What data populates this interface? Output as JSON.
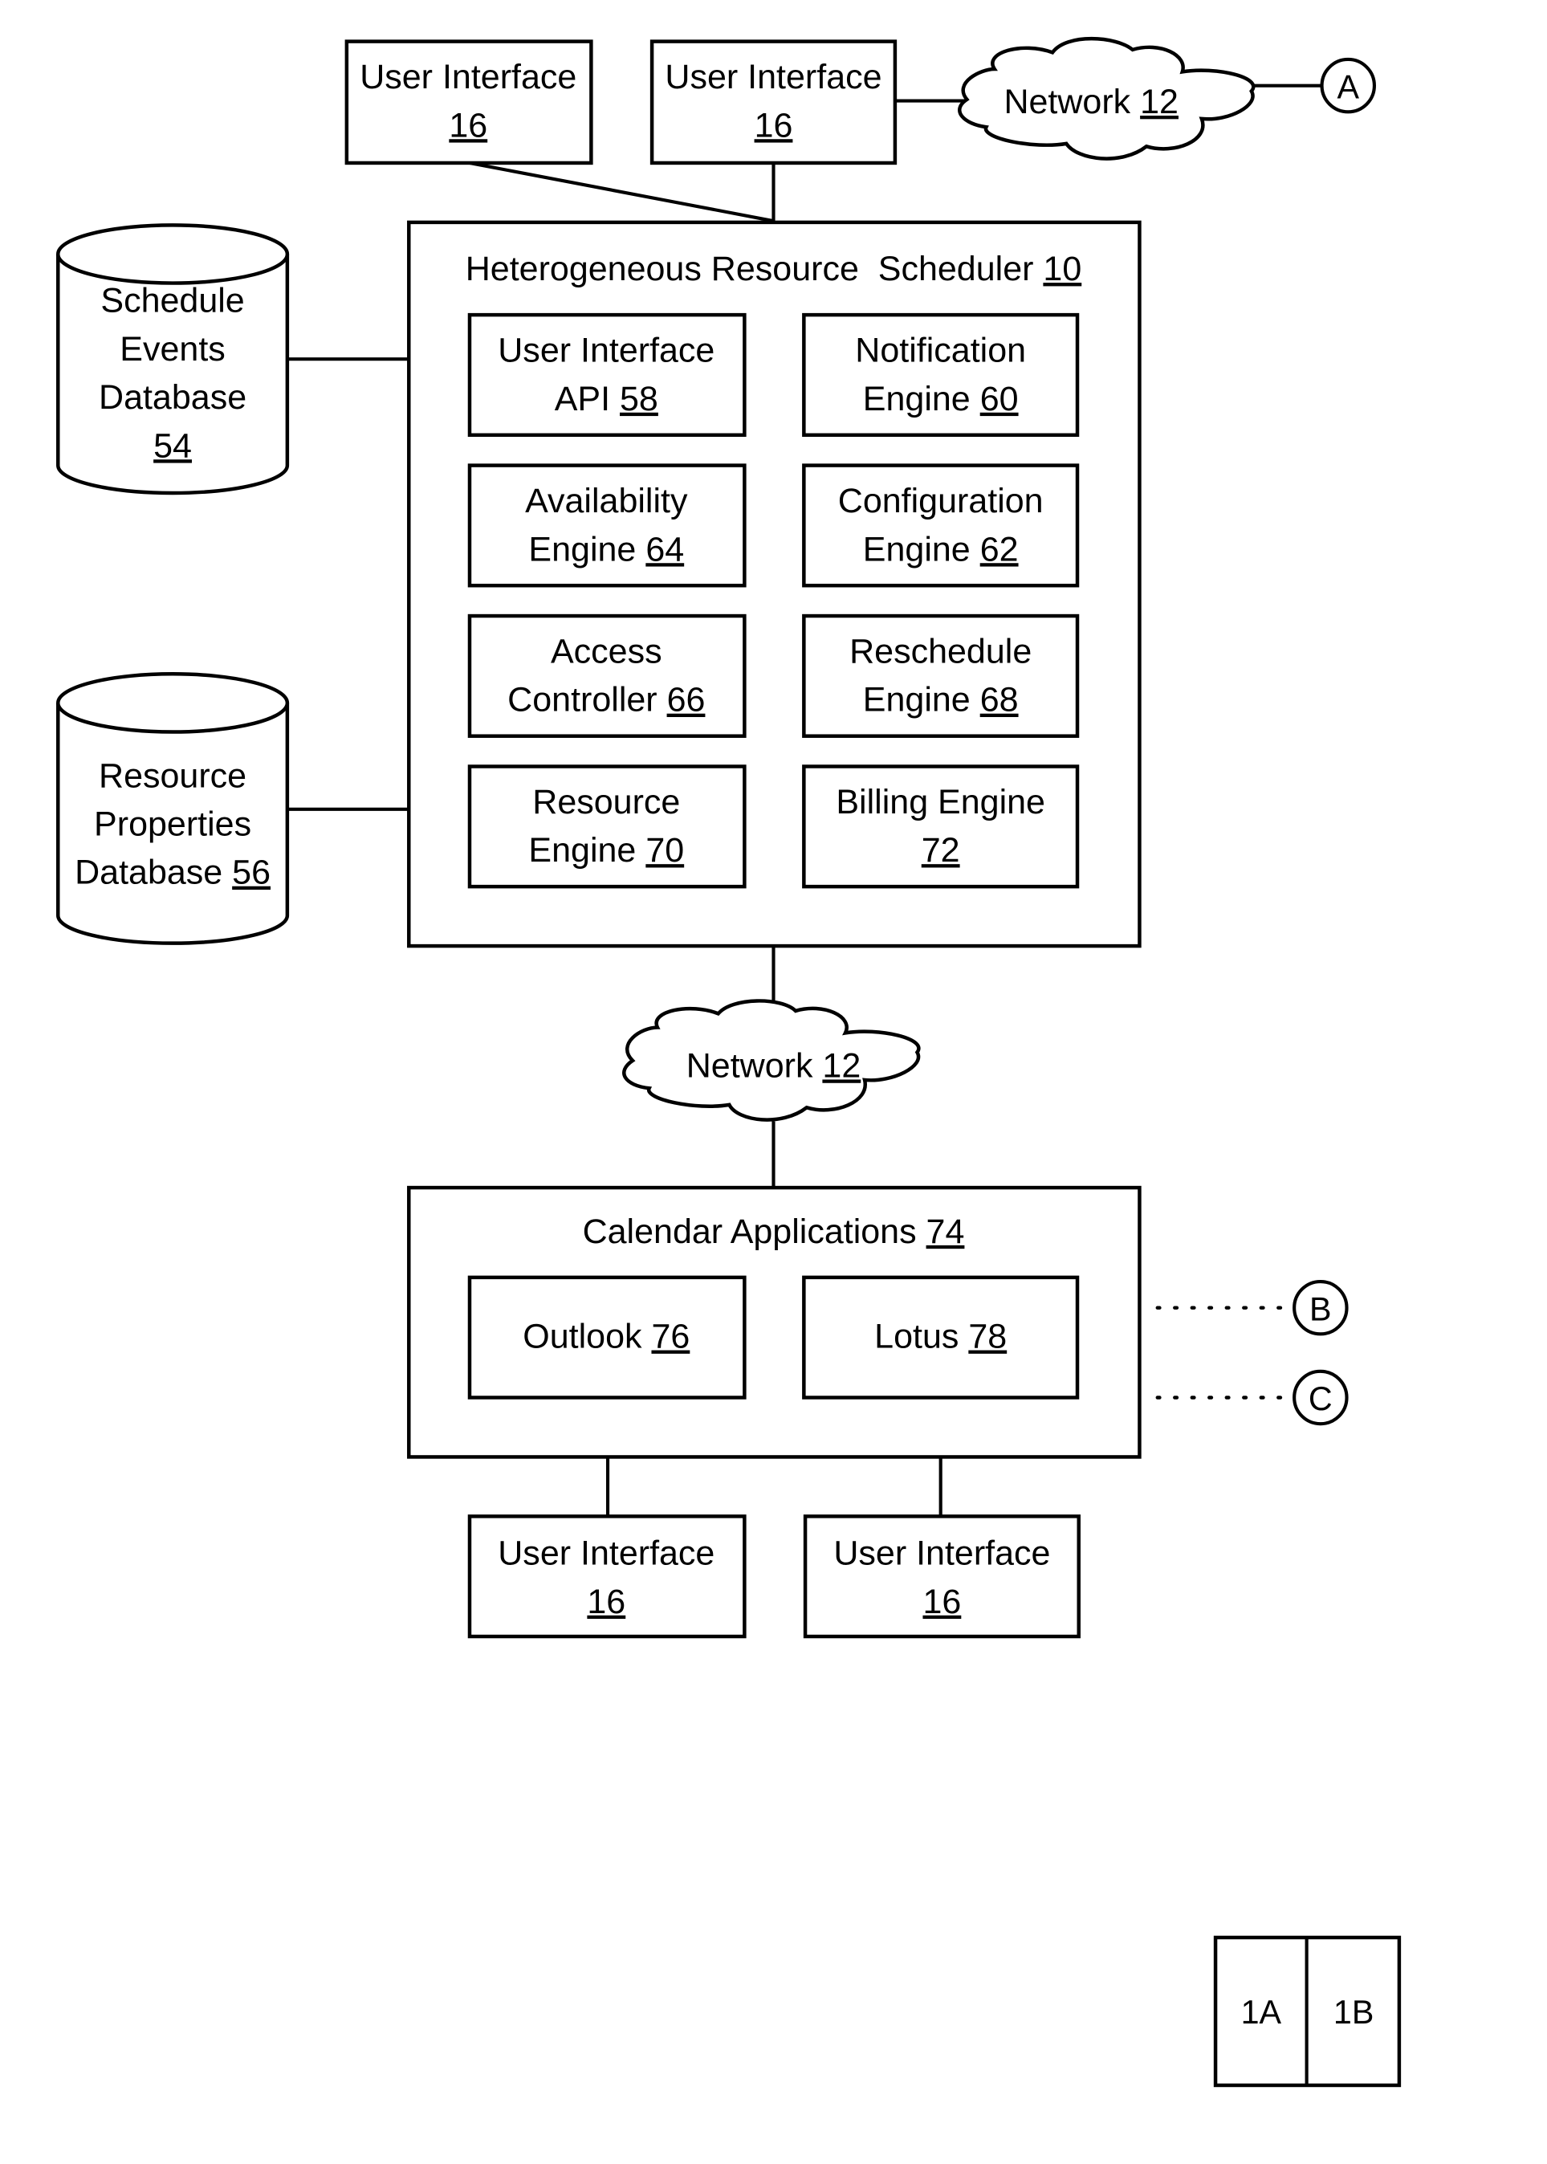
{
  "figure": {
    "top_user_interfaces": [
      {
        "name": "User Interface",
        "ref": "16"
      },
      {
        "name": "User Interface",
        "ref": "16"
      }
    ],
    "network_top": {
      "name": "Network",
      "ref": "12"
    },
    "connector_a": "A",
    "schedule_db": {
      "lines": [
        "Schedule",
        "Events",
        "Database"
      ],
      "ref": "54"
    },
    "resource_db": {
      "lines": [
        "Resource",
        "Properties",
        "Database"
      ],
      "ref": "56"
    },
    "scheduler": {
      "title": "Heterogeneous Resource  Scheduler",
      "ref": "10",
      "modules": [
        {
          "line1": "User Interface",
          "line2": "API",
          "ref": "58"
        },
        {
          "line1": "Notification",
          "line2": "Engine",
          "ref": "60"
        },
        {
          "line1": "Availability",
          "line2": "Engine",
          "ref": "64"
        },
        {
          "line1": "Configuration",
          "line2": "Engine",
          "ref": "62"
        },
        {
          "line1": "Access",
          "line2": "Controller",
          "ref": "66"
        },
        {
          "line1": "Reschedule",
          "line2": "Engine",
          "ref": "68"
        },
        {
          "line1": "Resource",
          "line2": "Engine",
          "ref": "70"
        },
        {
          "line1": "Billing Engine",
          "line2": "",
          "ref": "72"
        }
      ]
    },
    "network_mid": {
      "name": "Network",
      "ref": "12"
    },
    "calendar_apps": {
      "title": "Calendar Applications",
      "ref": "74",
      "apps": [
        {
          "name": "Outlook",
          "ref": "76"
        },
        {
          "name": "Lotus",
          "ref": "78"
        }
      ]
    },
    "connector_b": "B",
    "connector_c": "C",
    "bottom_user_interfaces": [
      {
        "name": "User Interface",
        "ref": "16"
      },
      {
        "name": "User Interface",
        "ref": "16"
      }
    ],
    "sheet_key": [
      "1A",
      "1B"
    ]
  }
}
